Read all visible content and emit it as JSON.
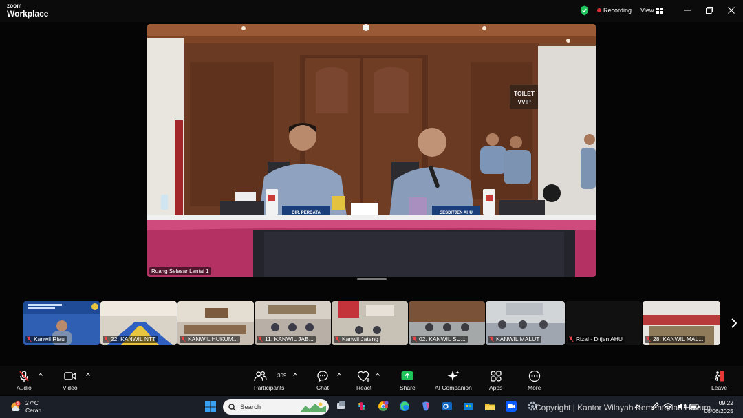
{
  "titlebar": {
    "logo_top": "zoom",
    "logo_bottom": "Workplace",
    "recording_label": "Recording",
    "view_label": "View"
  },
  "main_video": {
    "label": "Ruang Selasar Lantai 1",
    "sign_text_1": "TOILET",
    "sign_text_2": "VVIP",
    "nameplate_left": "DIR. PERDATA",
    "nameplate_right": "SESDITJEN AHU"
  },
  "gallery": {
    "tiles": [
      {
        "label": "Kanwil Riau"
      },
      {
        "label": "22. KANWIL NTT"
      },
      {
        "label": "KANWIL HUKUM..."
      },
      {
        "label": "11. KANWIL JAB..."
      },
      {
        "label": "Kanwil Jateng"
      },
      {
        "label": "02. KANWIL SU..."
      },
      {
        "label": "KANWIL MALUT"
      },
      {
        "label": "Rizal - Ditjen AHU"
      },
      {
        "label": "28. KANWIL MAL..."
      }
    ]
  },
  "toolbar": {
    "audio": "Audio",
    "video": "Video",
    "participants": "Participants",
    "participants_count": "309",
    "chat": "Chat",
    "react": "React",
    "share": "Share",
    "ai_companion": "AI Companion",
    "apps": "Apps",
    "more": "More",
    "leave": "Leave"
  },
  "taskbar": {
    "weather_temp": "27°C",
    "weather_desc": "Cerah",
    "weather_badge": "1",
    "search_placeholder": "Search",
    "time": "09.22",
    "date": "06/06/2025"
  },
  "watermark": "Copyright | Kantor Wilayah Kementerian Hukum"
}
